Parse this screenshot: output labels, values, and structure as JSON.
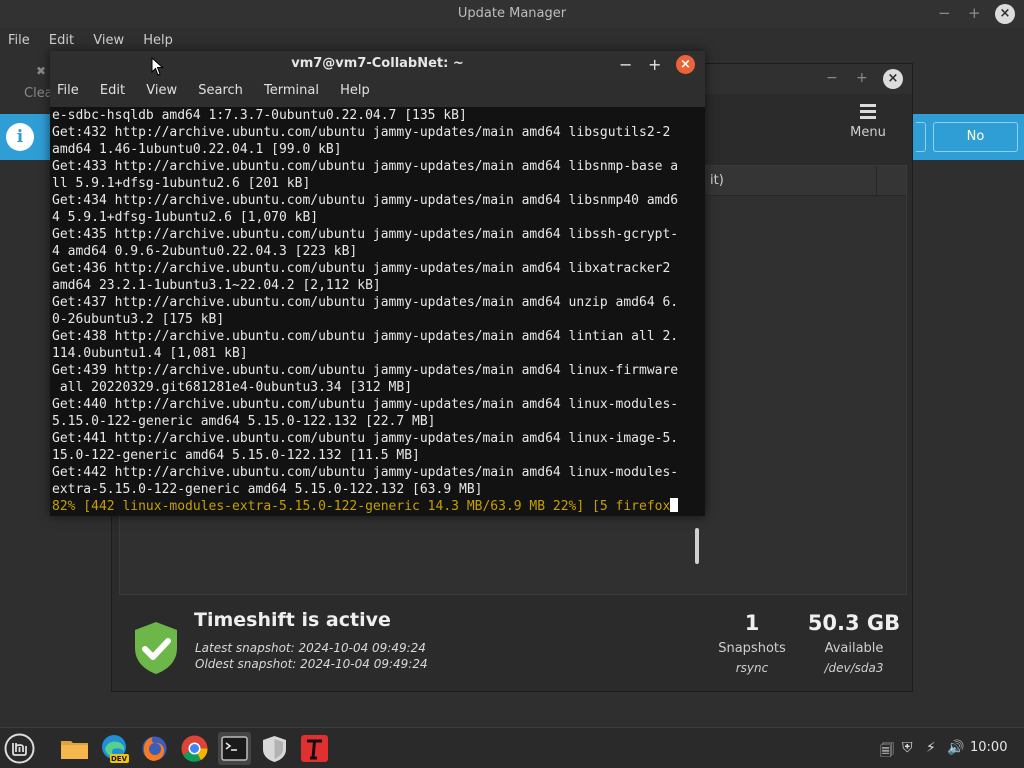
{
  "update_manager": {
    "title": "Update Manager",
    "window_controls": {
      "minimize": "−",
      "maximize": "+",
      "close": "×"
    },
    "menu": [
      "File",
      "Edit",
      "View",
      "Help"
    ],
    "toolbar_clear_label": "Clea",
    "infobar": {
      "no_button": "No",
      "info_icon_glyph": "i",
      "accent_color": "#2f9ed5"
    }
  },
  "timeshift": {
    "window_controls": {
      "minimize": "−",
      "maximize": "+",
      "close": "×"
    },
    "menu_button_label": "Menu",
    "list_header_partial": "it)",
    "status_title": "Timeshift is active",
    "latest_snapshot": "Latest snapshot: 2024-10-04 09:49:24",
    "oldest_snapshot": "Oldest snapshot: 2024-10-04 09:49:24",
    "stats": [
      {
        "value": "1",
        "caption": "Snapshots",
        "sub": "rsync"
      },
      {
        "value": "50.3 GB",
        "caption": "Available",
        "sub": "/dev/sda3"
      }
    ],
    "shield_color": "#6cb64a"
  },
  "terminal": {
    "title": "vm7@vm7-CollabNet: ~",
    "window_controls": {
      "minimize": "−",
      "maximize": "+",
      "close": "×"
    },
    "menu": [
      "File",
      "Edit",
      "View",
      "Search",
      "Terminal",
      "Help"
    ],
    "lines": [
      "e-sdbc-hsqldb amd64 1:7.3.7-0ubuntu0.22.04.7 [135 kB]",
      "Get:432 http://archive.ubuntu.com/ubuntu jammy-updates/main amd64 libsgutils2-2",
      "amd64 1.46-1ubuntu0.22.04.1 [99.0 kB]",
      "Get:433 http://archive.ubuntu.com/ubuntu jammy-updates/main amd64 libsnmp-base a",
      "ll 5.9.1+dfsg-1ubuntu2.6 [201 kB]",
      "Get:434 http://archive.ubuntu.com/ubuntu jammy-updates/main amd64 libsnmp40 amd6",
      "4 5.9.1+dfsg-1ubuntu2.6 [1,070 kB]",
      "Get:435 http://archive.ubuntu.com/ubuntu jammy-updates/main amd64 libssh-gcrypt-",
      "4 amd64 0.9.6-2ubuntu0.22.04.3 [223 kB]",
      "Get:436 http://archive.ubuntu.com/ubuntu jammy-updates/main amd64 libxatracker2",
      "amd64 23.2.1-1ubuntu3.1~22.04.2 [2,112 kB]",
      "Get:437 http://archive.ubuntu.com/ubuntu jammy-updates/main amd64 unzip amd64 6.",
      "0-26ubuntu3.2 [175 kB]",
      "Get:438 http://archive.ubuntu.com/ubuntu jammy-updates/main amd64 lintian all 2.",
      "114.0ubuntu1.4 [1,081 kB]",
      "Get:439 http://archive.ubuntu.com/ubuntu jammy-updates/main amd64 linux-firmware",
      " all 20220329.git681281e4-0ubuntu3.34 [312 MB]",
      "Get:440 http://archive.ubuntu.com/ubuntu jammy-updates/main amd64 linux-modules-",
      "5.15.0-122-generic amd64 5.15.0-122.132 [22.7 MB]",
      "Get:441 http://archive.ubuntu.com/ubuntu jammy-updates/main amd64 linux-image-5.",
      "15.0-122-generic amd64 5.15.0-122.132 [11.5 MB]",
      "Get:442 http://archive.ubuntu.com/ubuntu jammy-updates/main amd64 linux-modules-",
      "extra-5.15.0-122-generic amd64 5.15.0-122.132 [63.9 MB]"
    ],
    "progress_line": "82% [442 linux-modules-extra-5.15.0-122-generic 14.3 MB/63.9 MB 22%] [5 firefox",
    "progress_color": "#c4a000"
  },
  "taskbar": {
    "apps": [
      "mint-menu-icon",
      "files-folder-icon",
      "edge-dev-icon",
      "firefox-icon",
      "chrome-icon",
      "terminal-icon",
      "shield-icon",
      "text-editor-icon"
    ],
    "edge_badge": "DEV",
    "clock": "10:00"
  }
}
